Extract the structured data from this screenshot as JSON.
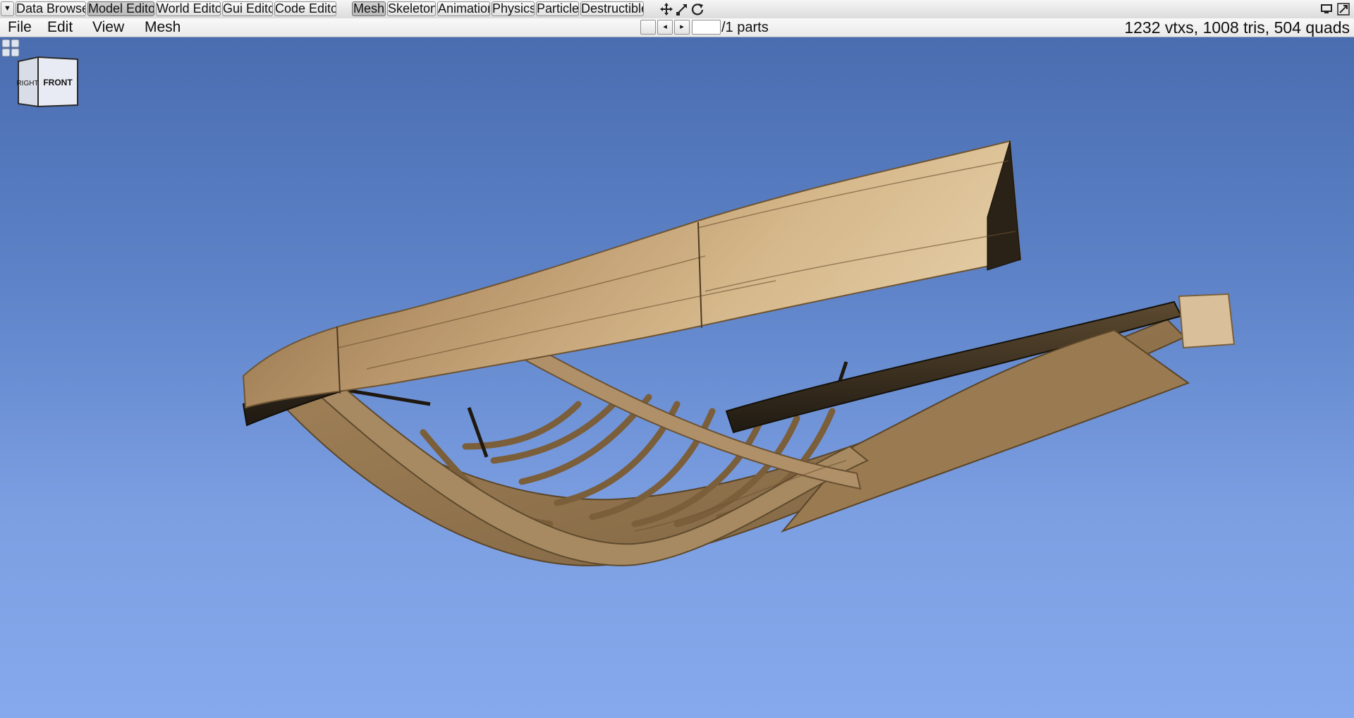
{
  "top_tabs": {
    "dropdown_glyph": "▼",
    "editors": [
      "Data Browser",
      "Model Editor",
      "World Editor",
      "Gui Editor",
      "Code Editor"
    ],
    "active_editor": "Model Editor",
    "modes": [
      "Mesh",
      "Skeleton",
      "Animation",
      "Physics",
      "Particle",
      "Destructible"
    ],
    "active_mode": "Mesh",
    "tool_icons": [
      "move-icon",
      "scale-icon",
      "rotate-icon"
    ],
    "window_icons": [
      "monitor-icon",
      "fullscreen-icon"
    ]
  },
  "menubar": {
    "menus": [
      "File",
      "Edit",
      "View",
      "Mesh"
    ],
    "part_nav": {
      "prev_glyph": "◂",
      "next_glyph": "▸",
      "part_value": "",
      "parts_suffix": "/1 parts"
    },
    "stats": "1232 vtxs, 1008 tris, 504 quads"
  },
  "viewport": {
    "view_cube": {
      "left_face": "RIGHT",
      "front_face": "FRONT"
    },
    "layout_icon": "viewport-layout-icon",
    "sky_colors": [
      "#4a6db0",
      "#86a8ec"
    ],
    "model": "wooden boat hull frame"
  }
}
